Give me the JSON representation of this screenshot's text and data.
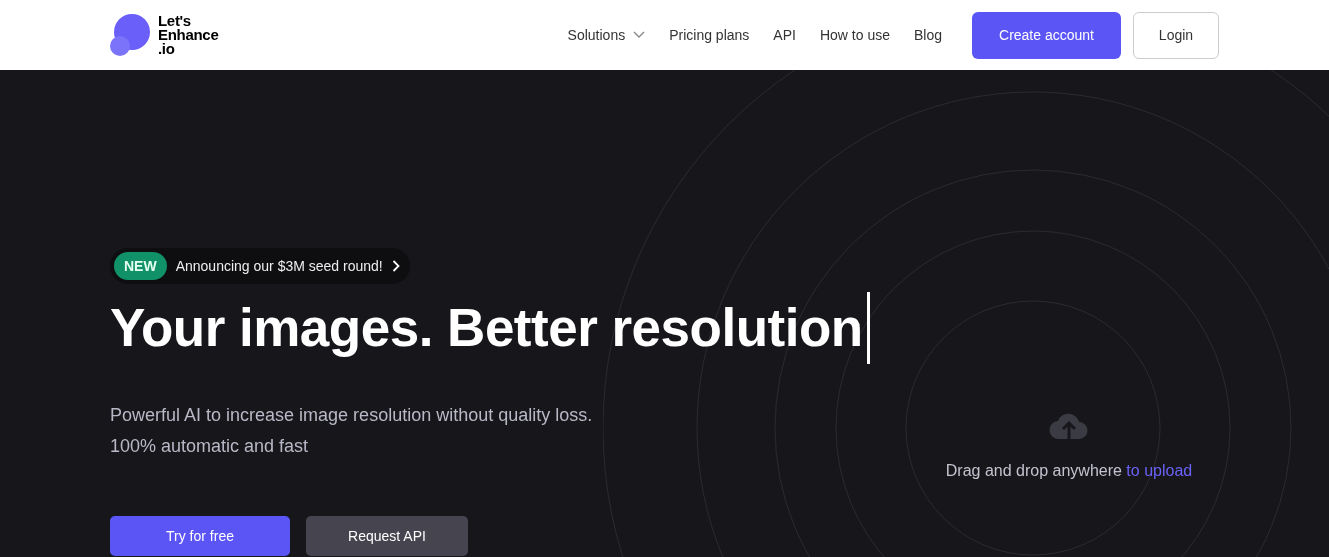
{
  "header": {
    "logo_lines": [
      "Let's",
      "Enhance",
      ".io"
    ],
    "nav": [
      {
        "label": "Solutions",
        "kind": "dropdown"
      },
      {
        "label": "Pricing plans",
        "kind": "link"
      },
      {
        "label": "API",
        "kind": "link"
      },
      {
        "label": "How to use",
        "kind": "link"
      },
      {
        "label": "Blog",
        "kind": "link"
      }
    ],
    "buttons": [
      {
        "label": "Create account",
        "kind": "primary"
      },
      {
        "label": "Login",
        "kind": "outline"
      }
    ]
  },
  "hero": {
    "badge": {
      "tag": "NEW",
      "text": "Announcing our $3M seed round!"
    },
    "heading": "Your images. Better resolution",
    "subtitle_lines": [
      "Powerful AI to increase image resolution without quality loss.",
      "100% automatic and fast"
    ],
    "buttons": [
      {
        "label": "Try for free",
        "kind": "primary"
      },
      {
        "label": "Request API",
        "kind": "secondary"
      }
    ],
    "upload": {
      "text": "Drag and drop anywhere",
      "link": "to upload"
    }
  }
}
